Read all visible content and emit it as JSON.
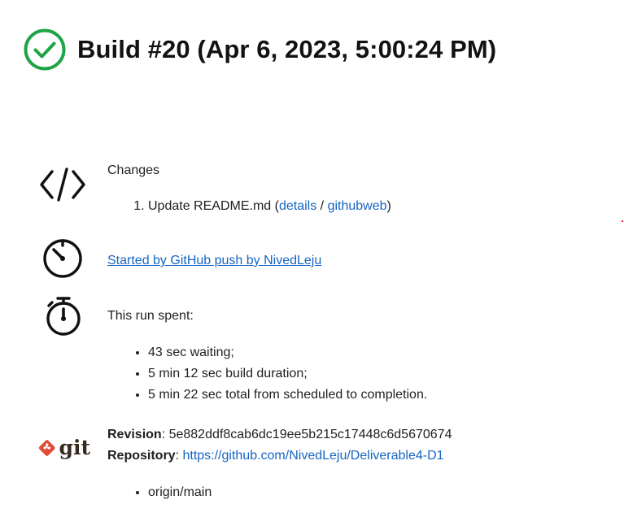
{
  "header": {
    "title": "Build #20 (Apr 6, 2023, 5:00:24 PM)",
    "status_icon": "check-circle-icon",
    "status_color": "#1ea446"
  },
  "changes": {
    "heading": "Changes",
    "icon": "code-icon",
    "items": [
      {
        "text": "Update README.md",
        "open_paren": "(",
        "details_label": "details",
        "separator": "/",
        "githubweb_label": "githubweb",
        "close_paren": ")"
      }
    ]
  },
  "trigger": {
    "icon": "timer-icon",
    "link_text": "Started by GitHub push by NivedLeju"
  },
  "timing": {
    "icon": "stopwatch-icon",
    "heading": "This run spent:",
    "items": [
      "43 sec waiting;",
      "5 min 12 sec build duration;",
      "5 min 22 sec total from scheduled to completion."
    ]
  },
  "git": {
    "icon": "git-logo-icon",
    "logo_text": "git",
    "logo_color": "#de4c36",
    "revision_label": "Revision",
    "revision_value": "5e882ddf8cab6dc19ee5b215c17448c6d5670674",
    "repository_label": "Repository",
    "repository_url": "https://github.com/NivedLeju/Deliverable4-D1",
    "branches": [
      "origin/main"
    ]
  },
  "colors": {
    "link": "#1665c2",
    "text": "#1f1f1f"
  }
}
